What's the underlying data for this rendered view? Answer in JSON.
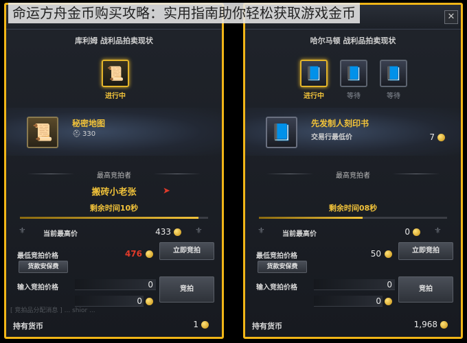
{
  "caption": "命运方舟金币购买攻略：实用指南助你轻松获取游戏金币",
  "accent_color": "#f2b617",
  "left_panel": {
    "title": "库利姆 战利品拍卖现状",
    "slot_status": "进行中",
    "slot_icon": "scroll-icon",
    "item_name": "秘密地图",
    "item_stat": "330",
    "highest_bidder_label": "最高竞拍者",
    "highest_bidder": "搬砖小老张",
    "time_left": "剩余时间10秒",
    "progress_fraction": 0.95,
    "current_price_label": "当前最高价",
    "current_price": "433",
    "min_bid_label": "最低竞拍价格",
    "min_bid": "476",
    "instant_buy": "立即竞拍",
    "escrow": "货款安保费",
    "input_label": "输入竞拍价格",
    "input_value": "0",
    "input_total": "0",
    "bid_button": "竞拍",
    "held_label": "持有货币",
    "held_value": "1",
    "chat_text": "[ 竞拍品分配消息 ] ... shior ..."
  },
  "right_panel": {
    "title": "哈尔马顿 战利品拍卖现状",
    "slots": [
      {
        "status": "进行中",
        "active": true
      },
      {
        "status": "等待",
        "active": false
      },
      {
        "status": "等待",
        "active": false
      }
    ],
    "item_name": "先发制人刻印书",
    "item_sub_label": "交易行最低价",
    "item_sub_value": "7",
    "highest_bidder_label": "最高竞拍者",
    "time_left": "剩余时间08秒",
    "progress_fraction": 0.55,
    "current_price_label": "当前最高价",
    "current_price": "0",
    "min_bid_label": "最低竞拍价格",
    "min_bid": "50",
    "instant_buy": "立即竞拍",
    "escrow": "货款安保费",
    "input_label": "输入竞拍价格",
    "input_value": "0",
    "input_total": "0",
    "bid_button": "竞拍",
    "held_label": "持有货币",
    "held_value": "1,968",
    "close_symbol": "✕"
  }
}
